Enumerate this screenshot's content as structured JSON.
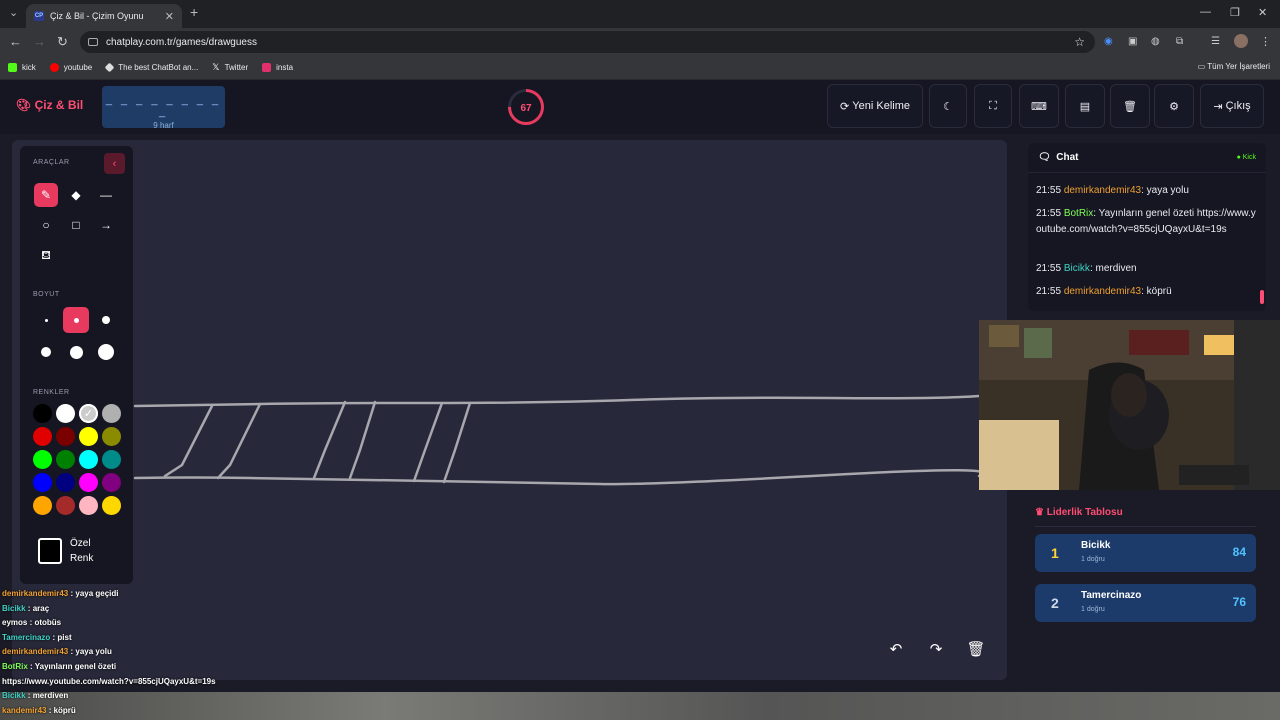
{
  "browser": {
    "tab_title": "Çiz & Bil - Çizim Oyunu",
    "tab_favicon": "CP",
    "url": "chatplay.com.tr/games/drawguess",
    "bookmarks": [
      {
        "label": "kick",
        "icon": "kick-icon",
        "color": "#53fc18"
      },
      {
        "label": "youtube",
        "icon": "youtube-icon",
        "color": "#ff0000"
      },
      {
        "label": "The best ChatBot an...",
        "icon": "chatbot-icon",
        "color": "#dddddd"
      },
      {
        "label": "Twitter",
        "icon": "x-icon",
        "color": "#ffffff"
      },
      {
        "label": "insta",
        "icon": "instagram-icon",
        "color": "#e1306c"
      }
    ],
    "all_bookmarks": "Tüm Yer İşaretleri"
  },
  "header": {
    "logo": "Çiz & Bil",
    "word_mask": "_ _ _ _ _ _ _ _ _",
    "word_hint": "9 harf",
    "timer": "67",
    "timer_fraction": 0.75,
    "new_word": "Yeni Kelime",
    "exit": "Çıkış"
  },
  "tools": {
    "section_tools": "ARAÇLAR",
    "section_size": "BOYUT",
    "section_colors": "RENKLER",
    "custom_color_1": "Özel",
    "custom_color_2": "Renk",
    "colors": [
      "#000000",
      "#ffffff",
      "#cccccc",
      "#b0b0b0",
      "#e00000",
      "#7a0000",
      "#ffff00",
      "#8b8b00",
      "#00ff00",
      "#008000",
      "#00ffff",
      "#008b8b",
      "#0000ff",
      "#000080",
      "#ff00ff",
      "#800080",
      "#ffa500",
      "#a52a2a",
      "#ffb6c1",
      "#ffd700"
    ],
    "selected_color_index": 2
  },
  "chat": {
    "title": "Chat",
    "platform": "Kick",
    "messages": [
      {
        "time": "21:55",
        "user": "demirkandemir43",
        "color": "#f0a030",
        "text": ": yaya yolu"
      },
      {
        "time": "21:55",
        "user": "BotRix",
        "color": "#7fff5a",
        "text": ": Yayınların genel özeti https://www.youtube.com/watch?v=855cjUQayxU&t=19s"
      },
      {
        "time": "21:55",
        "user": "Bicikk",
        "color": "#3fd2c7",
        "text": ": merdiven"
      },
      {
        "time": "21:55",
        "user": "demirkandemir43",
        "color": "#f0a030",
        "text": ": köprü"
      }
    ]
  },
  "leaderboard": {
    "title": "Liderlik Tablosu",
    "rows": [
      {
        "rank": "1",
        "name": "Bicikk",
        "correct": "1 doğru",
        "score": "84",
        "rank_color": "#ffd43b"
      },
      {
        "rank": "2",
        "name": "Tamercinazo",
        "correct": "1 doğru",
        "score": "76",
        "rank_color": "#cfd8e6"
      }
    ]
  },
  "overlay_chat": [
    {
      "user": "demirkandemir43",
      "text": " : yaya geçidi",
      "color": "#f0a030"
    },
    {
      "user": "Bicikk",
      "text": " : araç",
      "color": "#3fd2c7"
    },
    {
      "user": "eymos",
      "text": " : otobüs",
      "color": "#ffffff"
    },
    {
      "user": "Tamercinazo",
      "text": " : pist",
      "color": "#3fd2c7"
    },
    {
      "user": "demirkandemir43",
      "text": " : yaya yolu",
      "color": "#f0a030"
    },
    {
      "user": "BotRix",
      "text": " : Yayınların genel özeti",
      "color": "#7fff5a"
    },
    {
      "user": "",
      "text": "https://www.youtube.com/watch?v=855cjUQayxU&t=19s",
      "color": "#ffffff"
    },
    {
      "user": "Bicikk",
      "text": " : merdiven",
      "color": "#3fd2c7"
    },
    {
      "user": "kandemir43",
      "text": " : köprü",
      "color": "#f0a030"
    }
  ]
}
